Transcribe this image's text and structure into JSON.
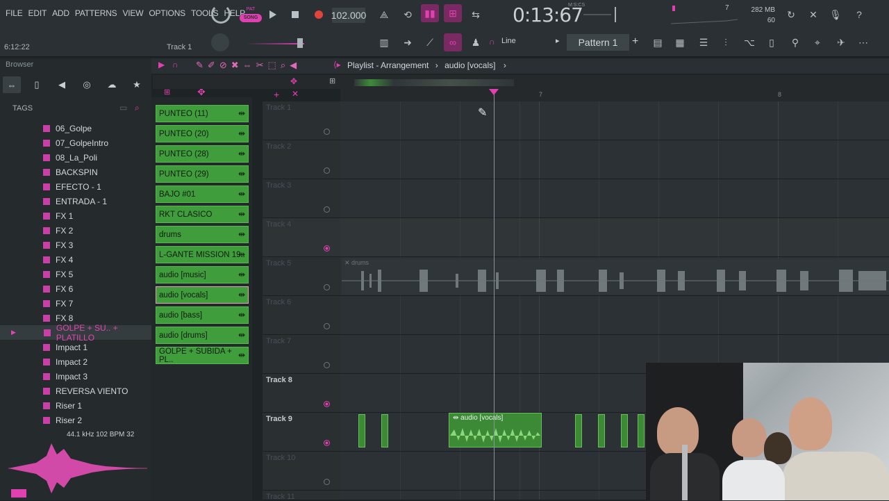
{
  "menu": [
    "FILE",
    "EDIT",
    "ADD",
    "PATTERNS",
    "VIEW",
    "OPTIONS",
    "TOOLS",
    "HELP"
  ],
  "transport": {
    "mode_pat": "PAT",
    "mode_song": "SONG",
    "tempo": "102.000",
    "time": "0:13:67",
    "time_units": "M:S:CS"
  },
  "memory": {
    "ram": "282 MB",
    "cpu": "60",
    "cpu_bar": "7"
  },
  "hint": "6:12:22",
  "focused_track": "Track 1",
  "snap": "Line",
  "pattern": "Pattern 1",
  "browser": {
    "title": "Browser",
    "tags_label": "TAGS",
    "items": [
      "06_Golpe",
      "07_GolpeIntro",
      "08_La_Poli",
      "BACKSPIN",
      "EFECTO - 1",
      "ENTRADA - 1",
      "FX 1",
      "FX 2",
      "FX 3",
      "FX 4",
      "FX 5",
      "FX 6",
      "FX 7",
      "FX 8",
      "GOLPE + SU.. + PLATILLO",
      "Impact 1",
      "Impact 2",
      "Impact 3",
      "REVERSA VIENTO",
      "Riser 1",
      "Riser 2"
    ],
    "selected_index": 14,
    "preview_info": "44.1 kHz 102 BPM 32"
  },
  "channels": [
    "PUNTEO (11)",
    "PUNTEO (20)",
    "PUNTEO (28)",
    "PUNTEO (29)",
    "BAJO #01",
    "RKT CLASICO",
    "drums",
    "L-GANTE MISSION 19..",
    "audio [music]",
    "audio [vocals]",
    "audio [bass]",
    "audio [drums]",
    "GOLPE + SUBIDA + PL.."
  ],
  "selected_channel": 9,
  "playlist": {
    "title": "Playlist - Arrangement",
    "breadcrumb": "audio [vocals]",
    "ruler": [
      "7",
      "8"
    ],
    "tracks": [
      "Track 1",
      "Track 2",
      "Track 3",
      "Track 4",
      "Track 5",
      "Track 6",
      "Track 7",
      "Track 8",
      "Track 9",
      "Track 10",
      "Track 11"
    ],
    "clips": {
      "drums": "drums",
      "vocals": "audio [vocals]"
    }
  },
  "colors": {
    "accent": "#e040b0",
    "clip_green": "#3f9e3b",
    "background": "#1e2326"
  }
}
